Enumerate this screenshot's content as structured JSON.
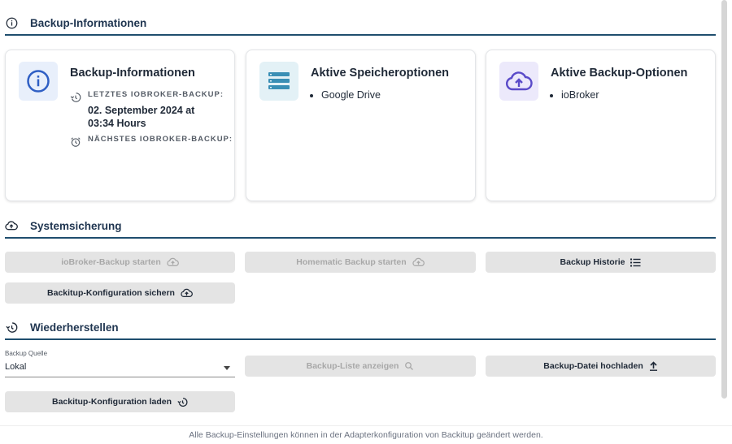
{
  "sections": {
    "info": {
      "title": "Backup-Informationen",
      "icon": "info-circle-icon"
    },
    "system": {
      "title": "Systemsicherung",
      "icon": "cloud-upload-icon"
    },
    "restore": {
      "title": "Wiederherstellen",
      "icon": "restore-icon"
    }
  },
  "cards": {
    "info": {
      "title": "Backup-Informationen",
      "icon": "info-icon",
      "last_label": "Letztes ioBroker-Backup:",
      "last_value": "02. September 2024 at 03:34 Hours",
      "next_label": "Nächstes ioBroker-Backup:"
    },
    "storage": {
      "title": "Aktive Speicheroptionen",
      "icon": "storage-list-icon",
      "items": [
        "Google Drive"
      ]
    },
    "options": {
      "title": "Aktive Backup-Optionen",
      "icon": "cloud-upload-icon",
      "items": [
        "ioBroker"
      ]
    }
  },
  "buttons": {
    "iobroker_start": "ioBroker-Backup starten",
    "homematic_start": "Homematic Backup starten",
    "history": "Backup Historie",
    "config_save": "Backitup-Konfiguration sichern",
    "list_show": "Backup-Liste anzeigen",
    "upload": "Backup-Datei hochladen",
    "config_load": "Backitup-Konfiguration laden"
  },
  "restore": {
    "source_label": "Backup Quelle",
    "source_value": "Lokal"
  },
  "footer": "Alle Backup-Einstellungen können in der Adapterkonfiguration von Backitup geändert werden.",
  "colors": {
    "accent": "#1f4e6e",
    "info_icon_bg": "#e8effb",
    "storage_icon_bg": "#e3f1f6",
    "options_icon_bg": "#ece9fb",
    "info_icon": "#2f5fc4",
    "storage_icon": "#3a8fb5",
    "options_icon": "#5a4bc9"
  }
}
